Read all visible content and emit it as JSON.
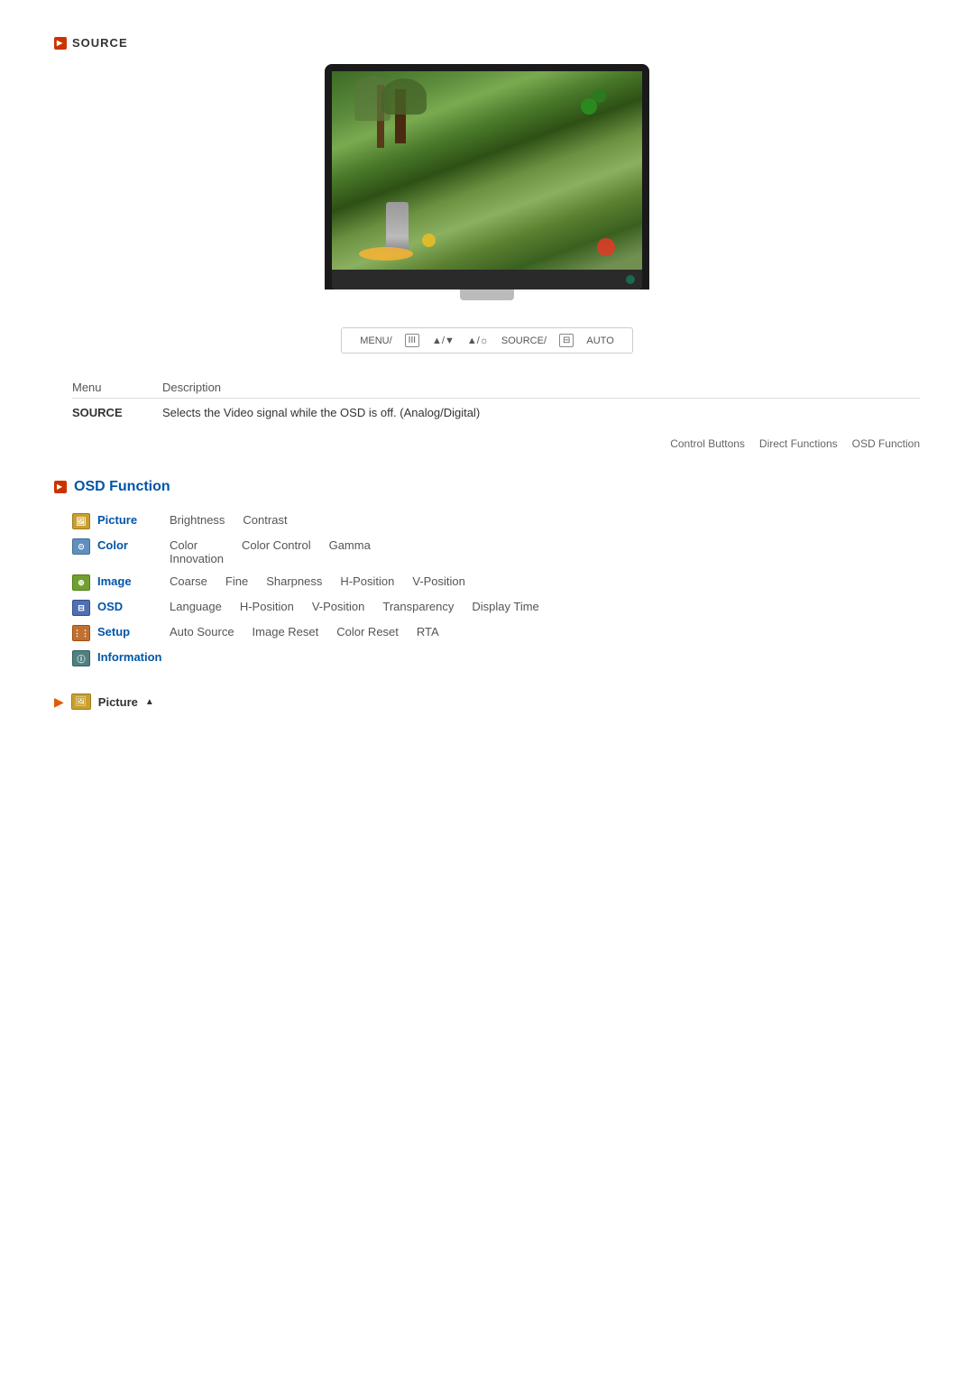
{
  "source_header": {
    "arrow": "▶",
    "label": "SOURCE"
  },
  "controls_bar": {
    "items": [
      {
        "label": "MENU/",
        "type": "text"
      },
      {
        "label": "III",
        "type": "box"
      },
      {
        "label": "▲▼/▼",
        "type": "symbol"
      },
      {
        "label": "▲/☼",
        "type": "symbol"
      },
      {
        "label": "SOURCE/",
        "type": "text"
      },
      {
        "label": "⊞",
        "type": "box"
      },
      {
        "label": "AUTO",
        "type": "text"
      }
    ]
  },
  "table": {
    "col_menu": "Menu",
    "col_desc": "Description",
    "rows": [
      {
        "menu": "SOURCE",
        "desc": "Selects the Video signal while the OSD is off. (Analog/Digital)"
      }
    ]
  },
  "nav_tabs": {
    "items": [
      "Control Buttons",
      "Direct Functions",
      "OSD Function"
    ]
  },
  "osd_section": {
    "title": "OSD Function",
    "rows": [
      {
        "icon_class": "icon-sq-picture",
        "icon_text": "🖼",
        "menu": "Picture",
        "subitems": [
          "Brightness",
          "Contrast"
        ]
      },
      {
        "icon_class": "icon-sq-color",
        "icon_text": "⊙",
        "menu": "Color",
        "subitems": [
          "Color Innovation",
          "Color Control",
          "Gamma"
        ]
      },
      {
        "icon_class": "icon-sq-image",
        "icon_text": "⊕",
        "menu": "Image",
        "subitems": [
          "Coarse",
          "Fine",
          "Sharpness",
          "H-Position",
          "V-Position"
        ]
      },
      {
        "icon_class": "icon-sq-osd",
        "icon_text": "⊟",
        "menu": "OSD",
        "subitems": [
          "Language",
          "H-Position",
          "V-Position",
          "Transparency",
          "Display Time"
        ]
      },
      {
        "icon_class": "icon-sq-setup",
        "icon_text": "⋮⋮",
        "menu": "Setup",
        "subitems": [
          "Auto Source",
          "Image Reset",
          "Color Reset",
          "RTA"
        ]
      },
      {
        "icon_class": "icon-sq-info",
        "icon_text": "ⓘ",
        "menu": "Information",
        "subitems": []
      }
    ]
  },
  "picture_footer": {
    "label": "Picture",
    "arrow": "▲"
  }
}
